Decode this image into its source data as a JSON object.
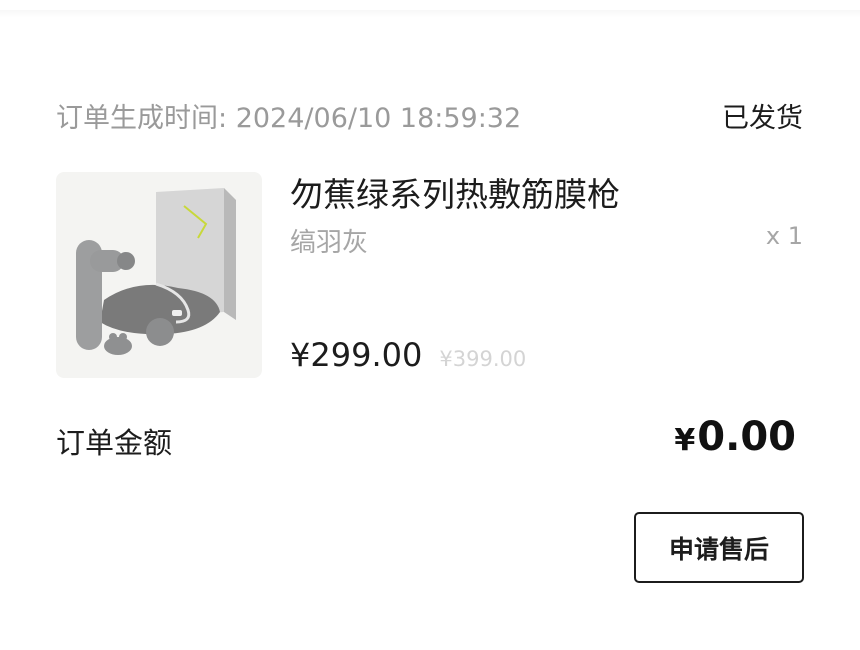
{
  "order": {
    "time_label": "订单生成时间:",
    "time_value": "2024/06/10 18:59:32",
    "status": "已发货"
  },
  "product": {
    "title": "勿蕉绿系列热敷筋膜枪",
    "variant": "缟羽灰",
    "quantity": "x 1",
    "price": "¥299.00",
    "original_price": "¥399.00"
  },
  "summary": {
    "total_label": "订单金额",
    "currency_symbol": "¥",
    "total_amount": "0.00"
  },
  "actions": {
    "after_sales_label": "申请售后"
  }
}
